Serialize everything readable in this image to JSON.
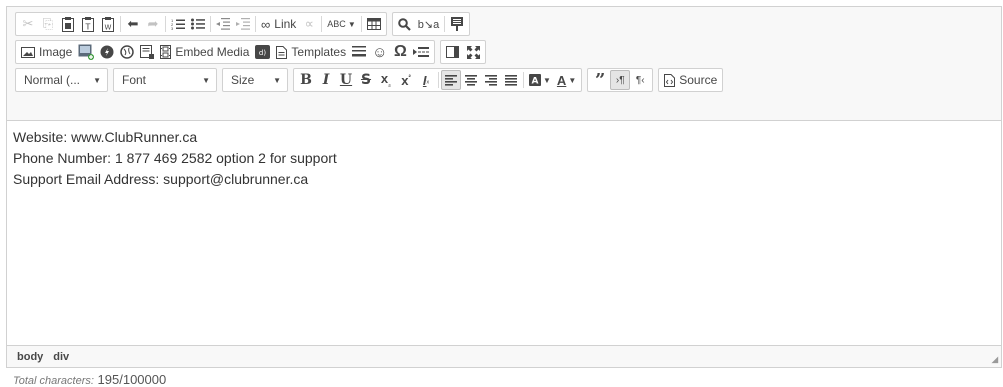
{
  "toolbar": {
    "link_label": "Link",
    "image_label": "Image",
    "embed_media_label": "Embed Media",
    "templates_label": "Templates",
    "format_combo": "Normal (...",
    "font_combo": "Font",
    "size_combo": "Size",
    "source_label": "Source",
    "bold_glyph": "B",
    "italic_glyph": "I",
    "underline_glyph": "U",
    "strike_glyph": "S"
  },
  "content": {
    "lines": [
      "Website: www.ClubRunner.ca",
      "Phone Number: 1 877 469 2582 option 2 for support",
      "Support Email Address: support@clubrunner.ca"
    ]
  },
  "statusbar": {
    "path": [
      "body",
      "div"
    ]
  },
  "counter": {
    "label": "Total characters:",
    "value": "195/100000"
  }
}
